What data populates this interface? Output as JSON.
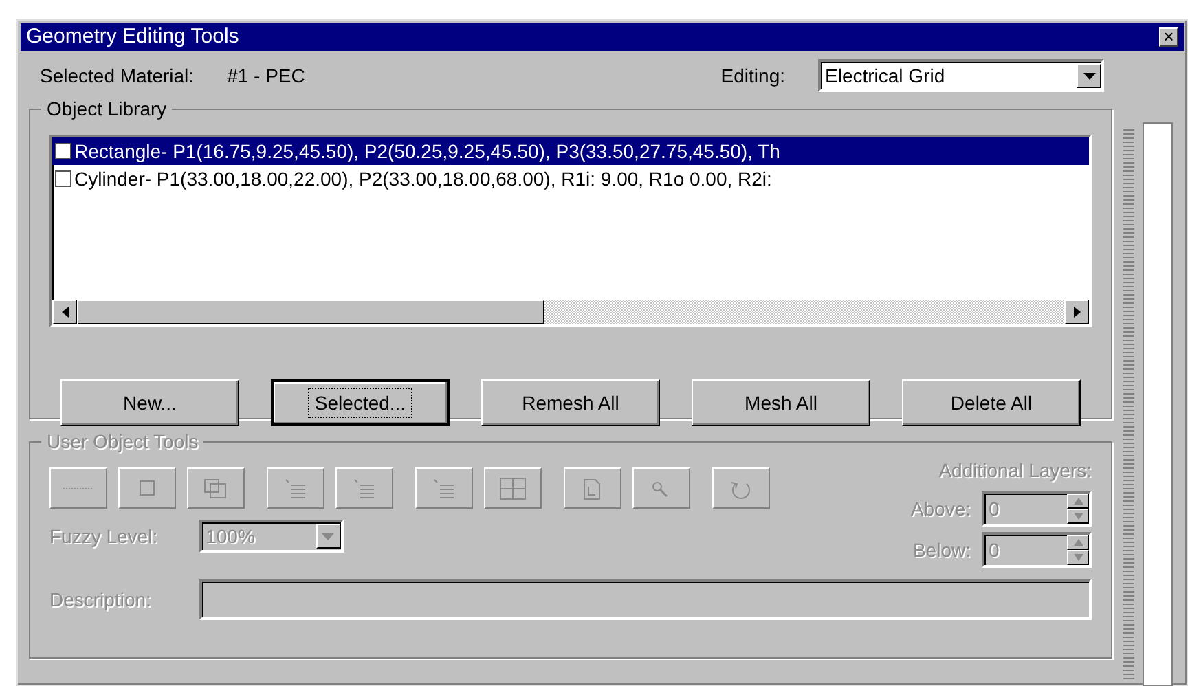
{
  "window": {
    "title": "Geometry Editing Tools",
    "close": "×"
  },
  "selected_material": {
    "label": "Selected Material:",
    "value": "#1 - PEC"
  },
  "editing": {
    "label": "Editing:",
    "value": "Electrical Grid"
  },
  "object_library": {
    "title": "Object Library",
    "items": [
      {
        "text": "Rectangle- P1(16.75,9.25,45.50), P2(50.25,9.25,45.50), P3(33.50,27.75,45.50), Th",
        "checked": false,
        "selected": true
      },
      {
        "text": "Cylinder- P1(33.00,18.00,22.00), P2(33.00,18.00,68.00), R1i: 9.00, R1o 0.00, R2i:",
        "checked": false,
        "selected": false
      }
    ],
    "buttons": [
      {
        "label": "New...",
        "focused": false
      },
      {
        "label": "Selected...",
        "focused": true
      },
      {
        "label": "Remesh All",
        "focused": false
      },
      {
        "label": "Mesh All",
        "focused": false
      },
      {
        "label": "Delete All",
        "focused": false
      }
    ]
  },
  "user_object_tools": {
    "title": "User Object Tools",
    "disabled": true,
    "tools": [
      {
        "kind": "line"
      },
      {
        "kind": "square"
      },
      {
        "kind": "copy"
      },
      {
        "kind": "list"
      },
      {
        "kind": "list"
      },
      {
        "kind": "list"
      },
      {
        "kind": "grid"
      },
      {
        "kind": "doc"
      },
      {
        "kind": "zoom"
      },
      {
        "kind": "rotate"
      }
    ],
    "fuzzy_level": {
      "label": "Fuzzy Level:",
      "value": "100%"
    },
    "additional_layers": {
      "label": "Additional Layers:",
      "above": {
        "label": "Above:",
        "value": "0"
      },
      "below": {
        "label": "Below:",
        "value": "0"
      }
    },
    "description": {
      "label": "Description:"
    }
  }
}
